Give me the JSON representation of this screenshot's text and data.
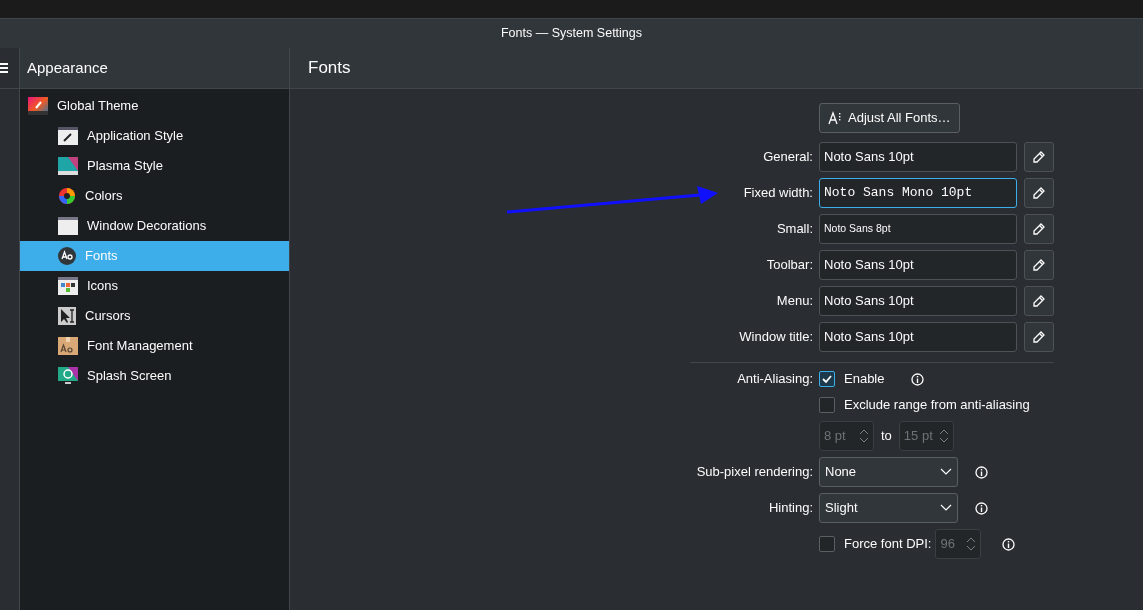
{
  "window": {
    "title": "Fonts — System Settings"
  },
  "sidebar": {
    "header": "Appearance",
    "items": [
      {
        "label": "Global Theme",
        "selected": false,
        "children": [
          {
            "label": "Application Style",
            "selected": false
          },
          {
            "label": "Plasma Style",
            "selected": false
          },
          {
            "label": "Colors",
            "selected": false
          },
          {
            "label": "Window Decorations",
            "selected": false
          },
          {
            "label": "Fonts",
            "selected": true
          },
          {
            "label": "Icons",
            "selected": false
          },
          {
            "label": "Cursors",
            "selected": false
          },
          {
            "label": "Font Management",
            "selected": false
          },
          {
            "label": "Splash Screen",
            "selected": false
          }
        ]
      }
    ]
  },
  "page": {
    "title": "Fonts",
    "adjust_button": "Adjust All Fonts…",
    "font_rows": [
      {
        "label": "General:",
        "value": "Noto Sans 10pt",
        "kind": "normal",
        "focused": false
      },
      {
        "label": "Fixed width:",
        "value": "Noto Sans Mono 10pt",
        "kind": "mono",
        "focused": true
      },
      {
        "label": "Small:",
        "value": "Noto Sans 8pt",
        "kind": "small",
        "focused": false
      },
      {
        "label": "Toolbar:",
        "value": "Noto Sans 10pt",
        "kind": "normal",
        "focused": false
      },
      {
        "label": "Menu:",
        "value": "Noto Sans 10pt",
        "kind": "normal",
        "focused": false
      },
      {
        "label": "Window title:",
        "value": "Noto Sans 10pt",
        "kind": "normal",
        "focused": false
      }
    ],
    "anti_aliasing": {
      "label": "Anti-Aliasing:",
      "enable": {
        "label": "Enable",
        "checked": true
      },
      "exclude": {
        "label": "Exclude range from anti-aliasing",
        "checked": false
      },
      "range": {
        "from": "8 pt",
        "to_label": "to",
        "to": "15 pt",
        "disabled": true
      }
    },
    "subpixel": {
      "label": "Sub-pixel rendering:",
      "value": "None"
    },
    "hinting": {
      "label": "Hinting:",
      "value": "Slight"
    },
    "force_dpi": {
      "label": "Force font DPI:",
      "checked": false,
      "value": "96",
      "disabled": true
    }
  }
}
